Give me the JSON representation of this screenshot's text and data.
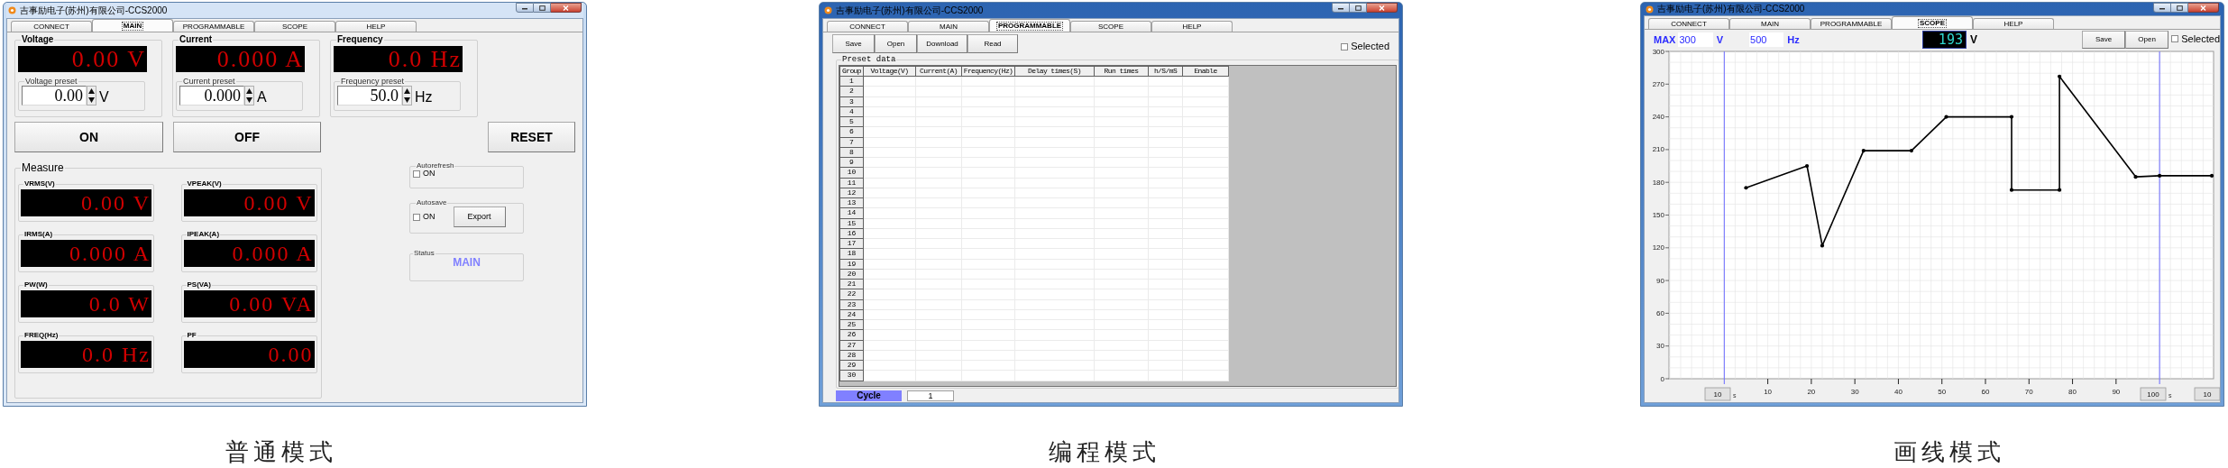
{
  "panels": [
    {
      "kind": "main",
      "window": {
        "title": "吉事励电子(苏州)有限公司-CCS2000",
        "active": false
      },
      "tabs": [
        {
          "label": "CONNECT",
          "selected": false
        },
        {
          "label": "MAIN",
          "selected": true
        },
        {
          "label": "PROGRAMMABLE",
          "selected": false
        },
        {
          "label": "SCOPE",
          "selected": false
        },
        {
          "label": "HELP",
          "selected": false
        }
      ],
      "controls": [
        {
          "label": "Voltage",
          "display": "0.00 V",
          "preset_label": "Voltage preset",
          "preset": "0.00",
          "unit": "V"
        },
        {
          "label": "Current",
          "display": "0.000 A",
          "preset_label": "Current preset",
          "preset": "0.000",
          "unit": "A"
        },
        {
          "label": "Frequency",
          "display": "0.0 Hz",
          "preset_label": "Frequency preset",
          "preset": "50.0",
          "unit": "Hz"
        }
      ],
      "buttons": [
        "ON",
        "OFF",
        "RESET"
      ],
      "measure": {
        "title": "Measure",
        "meters": [
          {
            "label": "VRMS(V)",
            "display": "0.00 V"
          },
          {
            "label": "VPEAK(V)",
            "display": "0.00 V"
          },
          {
            "label": "IRMS(A)",
            "display": "0.000 A"
          },
          {
            "label": "IPEAK(A)",
            "display": "0.000 A"
          },
          {
            "label": "PW(W)",
            "display": "0.0 W"
          },
          {
            "label": "PS(VA)",
            "display": "0.00 VA"
          },
          {
            "label": "FREQ(Hz)",
            "display": "0.0 Hz"
          },
          {
            "label": "PF",
            "display": "0.00"
          }
        ]
      },
      "autorefresh": {
        "title": "Autorefresh",
        "checkbox": {
          "label": "ON",
          "checked": false
        }
      },
      "autosave": {
        "title": "Autosave",
        "checkbox": {
          "label": "ON",
          "checked": false
        },
        "button": "Export"
      },
      "status": {
        "title": "Status",
        "value": "MAIN"
      },
      "caption": "普通模式"
    },
    {
      "kind": "programmable",
      "window": {
        "title": "吉事励电子(苏州)有限公司-CCS2000",
        "active": true
      },
      "tabs": [
        {
          "label": "CONNECT",
          "selected": false
        },
        {
          "label": "MAIN",
          "selected": false
        },
        {
          "label": "PROGRAMMABLE",
          "selected": true
        },
        {
          "label": "SCOPE",
          "selected": false
        },
        {
          "label": "HELP",
          "selected": false
        }
      ],
      "toolbar": [
        "Save",
        "Open",
        "Download",
        "Read"
      ],
      "selected_checkbox": {
        "label": "Selected",
        "checked": false
      },
      "preset_data": {
        "title": "Preset data",
        "columns": [
          "Group",
          "Voltage(V)",
          "Current(A)",
          "Frequency(Hz)",
          "Delay times(S)",
          "Run times",
          "h/S/mS",
          "Enable"
        ],
        "rows": [
          "1",
          "2",
          "3",
          "4",
          "5",
          "6",
          "7",
          "8",
          "9",
          "10",
          "11",
          "12",
          "13",
          "14",
          "15",
          "16",
          "17",
          "18",
          "19",
          "20",
          "21",
          "22",
          "23",
          "24",
          "25",
          "26",
          "27",
          "28",
          "29",
          "30"
        ]
      },
      "cycle": {
        "button": "Cycle",
        "value": "1"
      },
      "caption": "编程模式"
    },
    {
      "kind": "scope",
      "window": {
        "title": "吉事励电子(苏州)有限公司-CCS2000",
        "active": true
      },
      "tabs": [
        {
          "label": "CONNECT",
          "selected": false
        },
        {
          "label": "MAIN",
          "selected": false
        },
        {
          "label": "PROGRAMMABLE",
          "selected": false
        },
        {
          "label": "SCOPE",
          "selected": true
        },
        {
          "label": "HELP",
          "selected": false
        }
      ],
      "max": {
        "label": "MAX",
        "voltage": "300",
        "voltage_unit": "V",
        "frequency": "500",
        "frequency_unit": "Hz"
      },
      "reading": {
        "value": "193",
        "unit": "V"
      },
      "toolbar": [
        "Save",
        "Open"
      ],
      "selected_checkbox": {
        "label": "Selected",
        "checked": false
      },
      "chart_data": {
        "type": "line",
        "x": [
          5,
          19,
          22.5,
          32,
          43,
          51,
          66,
          66,
          77,
          77,
          94.5,
          100,
          112
        ],
        "series": [
          {
            "color": "#000000",
            "values": [
              175,
              195,
              122,
              209,
              209,
              240,
              240,
              173,
              173,
              277,
              185,
              186,
              186
            ]
          }
        ],
        "xlim": [
          -12.7,
          112.4
        ],
        "ylim": [
          0,
          300
        ],
        "xticks": [
          10,
          20,
          30,
          40,
          50,
          60,
          70,
          80,
          90
        ],
        "yticks": [
          0,
          30,
          60,
          90,
          120,
          150,
          180,
          210,
          240,
          270,
          300
        ],
        "grid": true,
        "ref_lines": [
          {
            "axis": "x",
            "value": 0,
            "color": "#6a6aff"
          },
          {
            "axis": "x",
            "value": 100,
            "color": "#6a6aff"
          }
        ]
      },
      "cursor_fields": [
        {
          "value": "10",
          "unit": "s"
        },
        {
          "value": "100",
          "unit": "s"
        },
        {
          "value": "10"
        }
      ],
      "caption": "画线模式"
    }
  ]
}
